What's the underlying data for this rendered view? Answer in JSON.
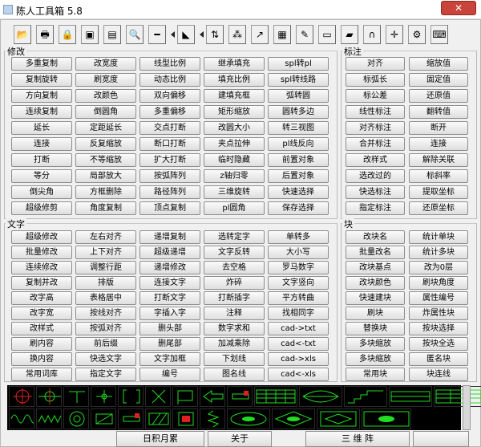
{
  "window": {
    "title": "陈人工具箱 5.8",
    "close_label": "✕"
  },
  "toolbar": [
    {
      "icon": "open-folder-icon",
      "glyph": "📂"
    },
    {
      "icon": "print-icon",
      "glyph": "🖶"
    },
    {
      "icon": "lock-icon",
      "glyph": "🔒"
    },
    {
      "icon": "disk-icon",
      "glyph": "▣"
    },
    {
      "icon": "table-icon",
      "glyph": "▤"
    },
    {
      "icon": "zoom-icon",
      "glyph": "🔍"
    },
    {
      "icon": "ruler-icon",
      "glyph": "━"
    },
    {
      "icon": "level-icon",
      "glyph": "◣"
    },
    {
      "icon": "dimension-icon",
      "glyph": "⇅"
    },
    {
      "icon": "points-icon",
      "glyph": "⁂"
    },
    {
      "icon": "export-icon",
      "glyph": "↗"
    },
    {
      "icon": "layers-icon",
      "glyph": "▦"
    },
    {
      "icon": "edit-doc-icon",
      "glyph": "✎"
    },
    {
      "icon": "monitor-icon",
      "glyph": "▭"
    },
    {
      "icon": "book-icon",
      "glyph": "▰"
    },
    {
      "icon": "magnet-icon",
      "glyph": "∩"
    },
    {
      "icon": "crosshair-icon",
      "glyph": "✛"
    },
    {
      "icon": "gear-icon",
      "glyph": "⚙"
    },
    {
      "icon": "keyboard-icon",
      "glyph": "⌨"
    }
  ],
  "groups": {
    "modify": {
      "label": "修改"
    },
    "annot": {
      "label": "标注"
    },
    "text": {
      "label": "文字"
    },
    "block": {
      "label": "块"
    }
  },
  "modify_rows": [
    [
      "多重复制",
      "改宽度",
      "线型比例",
      "继承填充",
      "spl转pl"
    ],
    [
      "复制旋转",
      "刷宽度",
      "动态比例",
      "填充比例",
      "spl转线路"
    ],
    [
      "方向复制",
      "改颜色",
      "双向偏移",
      "建填充框",
      "弧转圆"
    ],
    [
      "连续复制",
      "倒圆角",
      "多重偏移",
      "矩形缩放",
      "圆转多边"
    ],
    [
      "延长",
      "定距延长",
      "交点打断",
      "改圆大小",
      "转三视图"
    ],
    [
      "连接",
      "反复缩放",
      "断口打断",
      "夹点拉伸",
      "pl线反向"
    ],
    [
      "打断",
      "不等缩放",
      "扩大打断",
      "临时隐藏",
      "前置对象"
    ],
    [
      "等分",
      "局部放大",
      "按弧阵列",
      "z轴归零",
      "后置对象"
    ],
    [
      "倒尖角",
      "方框删除",
      "路径阵列",
      "三维旋转",
      "快速选择"
    ],
    [
      "超级修剪",
      "角度复制",
      "顶点复制",
      "pl圆角",
      "保存选择"
    ]
  ],
  "annot_rows": [
    [
      "对齐",
      "缩放值"
    ],
    [
      "标弧长",
      "固定值"
    ],
    [
      "标公差",
      "还原值"
    ],
    [
      "线性标注",
      "翻转值"
    ],
    [
      "对齐标注",
      "断开"
    ],
    [
      "合并标注",
      "连接"
    ],
    [
      "改样式",
      "解除关联"
    ],
    [
      "选改过的",
      "标斜率"
    ],
    [
      "快选标注",
      "提取坐标"
    ],
    [
      "指定标注",
      "还原坐标"
    ]
  ],
  "text_rows": [
    [
      "超级修改",
      "左右对齐",
      "递增复制",
      "选转定字",
      "单转多"
    ],
    [
      "批量修改",
      "上下对齐",
      "超级递增",
      "文字反转",
      "大小写"
    ],
    [
      "连续修改",
      "调整行距",
      "递增修改",
      "去空格",
      "罗马数字"
    ],
    [
      "复制并改",
      "排版",
      "连接文字",
      "炸碎",
      "文字竖向"
    ],
    [
      "改字高",
      "表格居中",
      "打断文字",
      "打断插字",
      "平方转曲"
    ],
    [
      "改字宽",
      "按线对齐",
      "字插入字",
      "注释",
      "找相同字"
    ],
    [
      "改样式",
      "按弧对齐",
      "删头部",
      "数字求和",
      "cad->txt"
    ],
    [
      "刷内容",
      "前后缀",
      "删尾部",
      "加减乘除",
      "cad<-txt"
    ],
    [
      "换内容",
      "快选文字",
      "文字加框",
      "下划线",
      "cad->xls"
    ],
    [
      "常用词库",
      "指定文字",
      "编号",
      "图名线",
      "cad<-xls"
    ]
  ],
  "block_rows": [
    [
      "改块名",
      "统计单块"
    ],
    [
      "批量改名",
      "统计多块"
    ],
    [
      "改块基点",
      "改为0层"
    ],
    [
      "改块颜色",
      "刷块角度"
    ],
    [
      "快速建块",
      "属性编号"
    ],
    [
      "刷块",
      "炸属性块"
    ],
    [
      "替换块",
      "按块选择"
    ],
    [
      "多块缩放",
      "按块全选"
    ],
    [
      "多块缩放",
      "匿名块"
    ],
    [
      "常用块",
      "块连线"
    ]
  ],
  "symbols_row1": [
    "target-symbol",
    "crosshair-symbol",
    "tee-symbol",
    "plus-symbol",
    "bracket-symbol",
    "cross-symbol",
    "flag-symbol",
    "arrow-symbol",
    "bar-symbol",
    "grid-symbol",
    "cabinet-symbol",
    "stair-symbol",
    "wall-symbol",
    "rack-symbol"
  ],
  "symbols_row2": [
    "wave-symbol",
    "zigzag-symbol",
    "circle-symbol",
    "plate-symbol",
    "bar-symbol",
    "hatch-symbol",
    "square-symbol",
    "spring-symbol",
    "oval-symbol",
    "diamond-symbol",
    "frame-symbol",
    "panel-symbol"
  ],
  "bottom": {
    "calendar": "日积月累",
    "about": "关于",
    "info": "三 维 阵"
  },
  "colors": {
    "symbol_bg": "#000000",
    "symbol_line": "#22dd22",
    "symbol_red": "#e02020"
  }
}
